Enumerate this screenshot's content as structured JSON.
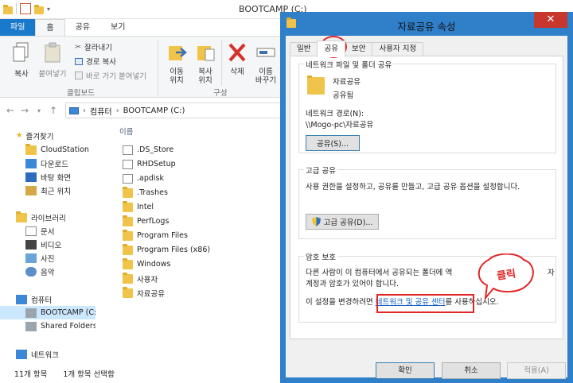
{
  "explorer": {
    "window_title": "BOOTCAMP (C:)",
    "tabs": [
      "파일",
      "홈",
      "공유",
      "보기"
    ],
    "ribbon": {
      "copy": "복사",
      "paste": "붙여넣기",
      "cut": "잘라내기",
      "copy_path": "경로 복사",
      "paste_shortcut": "바로 가기 붙여넣기",
      "clipboard_group": "클립보드",
      "move_to": "이동\n위치",
      "copy_to": "복사\n위치",
      "delete": "삭제",
      "rename": "이름\n바꾸기",
      "organize_group": "구성"
    },
    "breadcrumb": [
      "컴퓨터",
      "BOOTCAMP (C:)"
    ],
    "nav": {
      "favorites": "즐겨찾기",
      "favorites_items": [
        "CloudStation",
        "다운로드",
        "바탕 화면",
        "최근 위치"
      ],
      "libraries": "라이브러리",
      "libraries_items": [
        "문서",
        "비디오",
        "사진",
        "음악"
      ],
      "computer": "컴퓨터",
      "computer_items": [
        "BOOTCAMP (C:)",
        "Shared Folders(\\\\"
      ],
      "network": "네트워크"
    },
    "column_header": "이름",
    "files": [
      ".DS_Store",
      "RHDSetup",
      ".apdisk",
      ".Trashes",
      "Intel",
      "PerfLogs",
      "Program Files",
      "Program Files (x86)",
      "Windows",
      "사용자",
      "자료공유"
    ],
    "status": {
      "count": "11개 항목",
      "selected": "1개 항목 선택함"
    }
  },
  "dialog": {
    "title": "자료공유 속성",
    "tabs": [
      "일반",
      "공유",
      "보안",
      "사용자 지정"
    ],
    "section_share": {
      "label": "네트워크 파일 및 폴더 공유",
      "folder_name": "자료공유",
      "share_state": "공유됨",
      "path_label": "네트워크 경로(N):",
      "path_value": "\\\\Mogo-pc\\자료공유",
      "button": "공유(S)..."
    },
    "section_advanced": {
      "label": "고급 공유",
      "description": "사용 권한을 설정하고, 공유를 만들고, 고급 공유 옵션을 설정합니다.",
      "button": "고급 공유(D)..."
    },
    "section_password": {
      "label": "암호 보호",
      "line1": "다른 사람이 이 컴퓨터에서 공유되는 폴더에 액",
      "line1_tail": "자",
      "line2": "계정과 암호가 있어야 합니다.",
      "line3_prefix": "이 설정을 변경하려면",
      "link": "네트워크 및 공유 센터",
      "line3_suffix": "를 사용하십시오."
    },
    "buttons": {
      "ok": "확인",
      "cancel": "취소",
      "apply": "적용(A)"
    },
    "callout_text": "클릭",
    "highlight_color": "#e02727"
  }
}
